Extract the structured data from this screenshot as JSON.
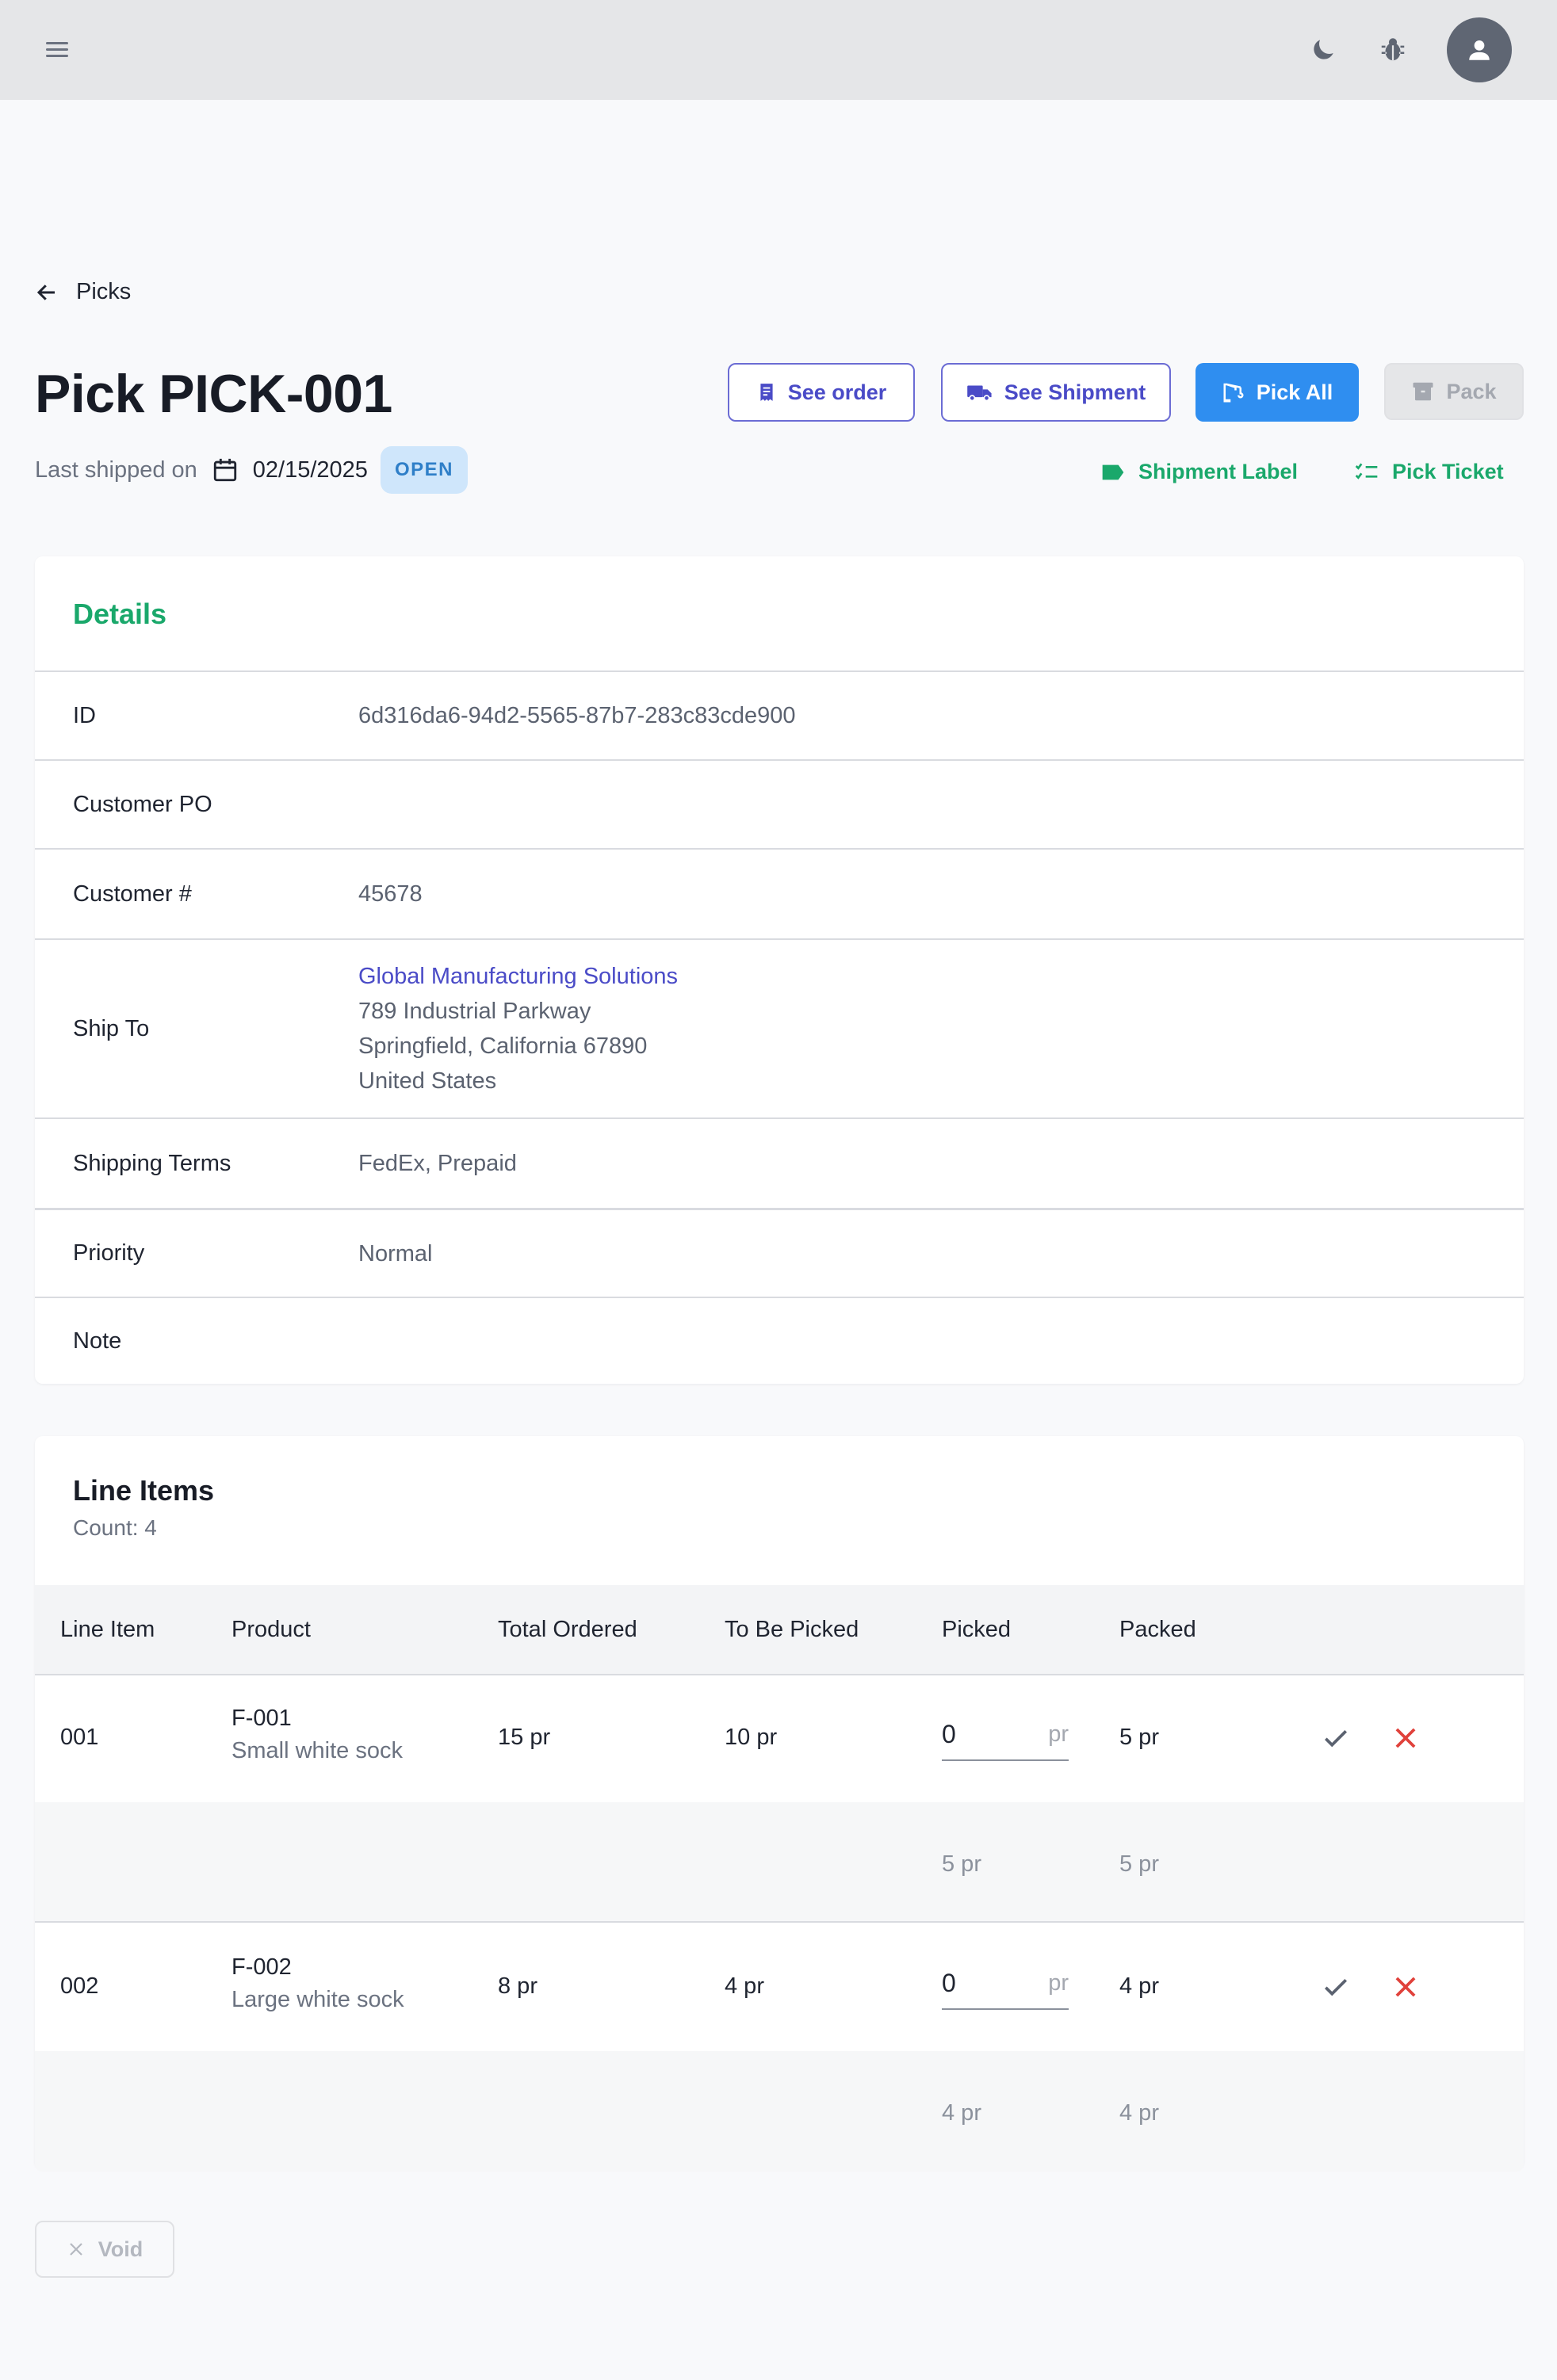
{
  "nav": {
    "back_label": "Picks"
  },
  "header": {
    "title": "Pick PICK-001",
    "last_shipped_label": "Last shipped on",
    "last_shipped_date": "02/15/2025",
    "status": "OPEN"
  },
  "actions": {
    "see_order": "See order",
    "see_shipment": "See Shipment",
    "pick_all": "Pick All",
    "pack": "Pack",
    "shipment_label": "Shipment Label",
    "pick_ticket": "Pick Ticket"
  },
  "details": {
    "title": "Details",
    "rows": [
      {
        "label": "ID",
        "value": "6d316da6-94d2-5565-87b7-283c83cde900"
      },
      {
        "label": "Customer PO",
        "value": ""
      },
      {
        "label": "Customer #",
        "value": "45678"
      },
      {
        "label": "Ship To",
        "lines": [
          "Global Manufacturing Solutions",
          "789 Industrial Parkway",
          "Springfield, California 67890",
          "United States"
        ]
      },
      {
        "label": "Shipping Terms",
        "value": "FedEx, Prepaid"
      },
      {
        "label": "Priority",
        "value": "Normal"
      },
      {
        "label": "Note",
        "value": ""
      }
    ]
  },
  "line_items": {
    "title": "Line Items",
    "count": "Count: 4",
    "columns": [
      "Line Item",
      "Product",
      "Total Ordered",
      "To Be Picked",
      "Picked",
      "Packed"
    ],
    "rows": [
      {
        "line": "001",
        "code": "F-001",
        "desc": "Small white sock",
        "ordered": "15 pr",
        "to_pick": "10 pr",
        "picked": "0",
        "unit": "pr",
        "packed": "5 pr",
        "sub_picked": "5 pr",
        "sub_packed": "5 pr"
      },
      {
        "line": "002",
        "code": "F-002",
        "desc": "Large white sock",
        "ordered": "8 pr",
        "to_pick": "4 pr",
        "picked": "0",
        "unit": "pr",
        "packed": "4 pr",
        "sub_picked": "4 pr",
        "sub_packed": "4 pr"
      }
    ]
  },
  "footer": {
    "void_label": "Void"
  },
  "colors": {
    "accent_green": "#1aa86b",
    "primary_blue": "#2f8ef0",
    "indigo": "#4a4bc7",
    "danger": "#e0413b"
  }
}
